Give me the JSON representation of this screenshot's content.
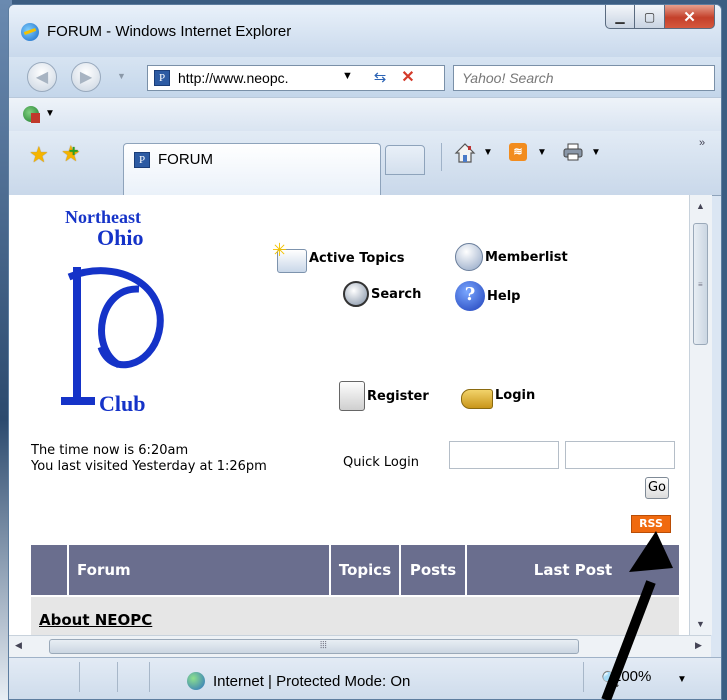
{
  "window": {
    "title": "FORUM - Windows Internet Explorer"
  },
  "navigation": {
    "url": "http://www.neopc.",
    "search_placeholder": "Yahoo! Search"
  },
  "tab": {
    "title": "FORUM"
  },
  "logo": {
    "line1": "Northeast",
    "line2": "Ohio",
    "line3": "Club"
  },
  "forum_links": [
    {
      "label": "Active Topics",
      "icon": "active-topics-icon"
    },
    {
      "label": "Memberlist",
      "icon": "memberlist-icon"
    },
    {
      "label": "Search",
      "icon": "search-icon"
    },
    {
      "label": "Help",
      "icon": "help-icon"
    },
    {
      "label": "Register",
      "icon": "register-icon"
    },
    {
      "label": "Login",
      "icon": "key-icon"
    }
  ],
  "session": {
    "time_text": "The time now is 6:20am",
    "last_visit_text": "You last visited Yesterday at 1:26pm"
  },
  "quick_login": {
    "label": "Quick Login",
    "username_value": "",
    "password_value": "",
    "go_label": "Go"
  },
  "rss_label": "RSS",
  "forum_table": {
    "headers": [
      "Forum",
      "Topics",
      "Posts",
      "Last Post"
    ],
    "rows": [
      {
        "label": "About NEOPC"
      }
    ]
  },
  "statusbar": {
    "zone": "Internet | Protected Mode: On",
    "zoom": "100%"
  },
  "colors": {
    "header_bg": "#6a6e8e",
    "logo_blue": "#1533c8",
    "rss_orange": "#f06a0f",
    "arrow": "#000000"
  }
}
